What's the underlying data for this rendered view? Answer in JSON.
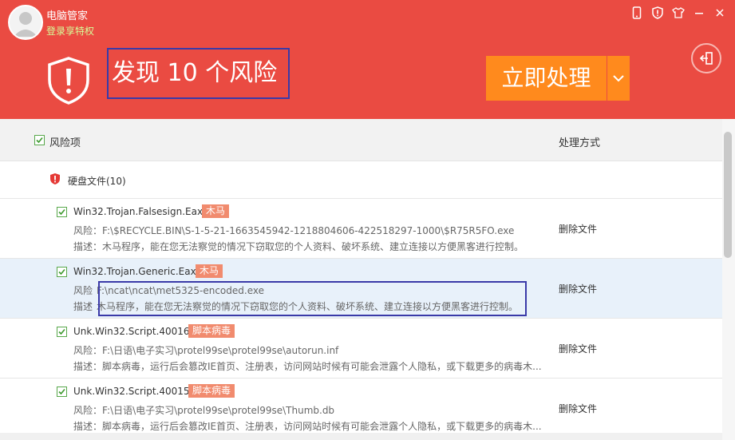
{
  "header": {
    "app_title": "电脑管家",
    "login_link": "登录享特权",
    "risk_title": "发现 10 个风险",
    "process_button": "立即处理",
    "colors": {
      "header_bg": "#ea4b42",
      "button_bg": "#ff8a1d",
      "tag_bg": "#f18b6e"
    }
  },
  "top_icons": [
    "phone-icon",
    "shield-icon",
    "tshirt-icon",
    "minimize-icon",
    "close-icon"
  ],
  "table": {
    "header_risk": "风险项",
    "header_action": "处理方式",
    "group_label": "硬盘文件(10)",
    "rows": [
      {
        "name": "Win32.Trojan.Falsesign.Eaxe",
        "tag": "木马",
        "path_label": "风险：",
        "path": "F:\\$RECYCLE.BIN\\S-1-5-21-1663545942-1218804606-422518297-1000\\$R75R5FO.exe",
        "desc_label": "描述：",
        "desc": "木马程序，能在您无法察觉的情况下窃取您的个人资料、破坏系统、建立连接以方便黑客进行控制。",
        "action": "删除文件"
      },
      {
        "name": "Win32.Trojan.Generic.Eaxa",
        "tag": "木马",
        "path_label": "风险",
        "path": "F:\\ncat\\ncat\\met5325-encoded.exe",
        "desc_label": "描述",
        "desc": "木马程序，能在您无法察觉的情况下窃取您的个人资料、破坏系统、建立连接以方便黑客进行控制。",
        "action": "删除文件"
      },
      {
        "name": "Unk.Win32.Script.400161",
        "tag": "脚本病毒",
        "path_label": "风险：",
        "path": "F:\\日语\\电子实习\\protel99se\\protel99se\\autorun.inf",
        "desc_label": "描述：",
        "desc": "脚本病毒，运行后会篡改IE首页、注册表，访问网站时候有可能会泄露个人隐私，或下载更多的病毒木...",
        "action": "删除文件"
      },
      {
        "name": "Unk.Win32.Script.400159",
        "tag": "脚本病毒",
        "path_label": "风险：",
        "path": "F:\\日语\\电子实习\\protel99se\\protel99se\\Thumb.db",
        "desc_label": "描述：",
        "desc": "脚本病毒，运行后会篡改IE首页、注册表，访问网站时候有可能会泄露个人隐私，或下载更多的病毒木...",
        "action": "删除文件"
      }
    ]
  }
}
